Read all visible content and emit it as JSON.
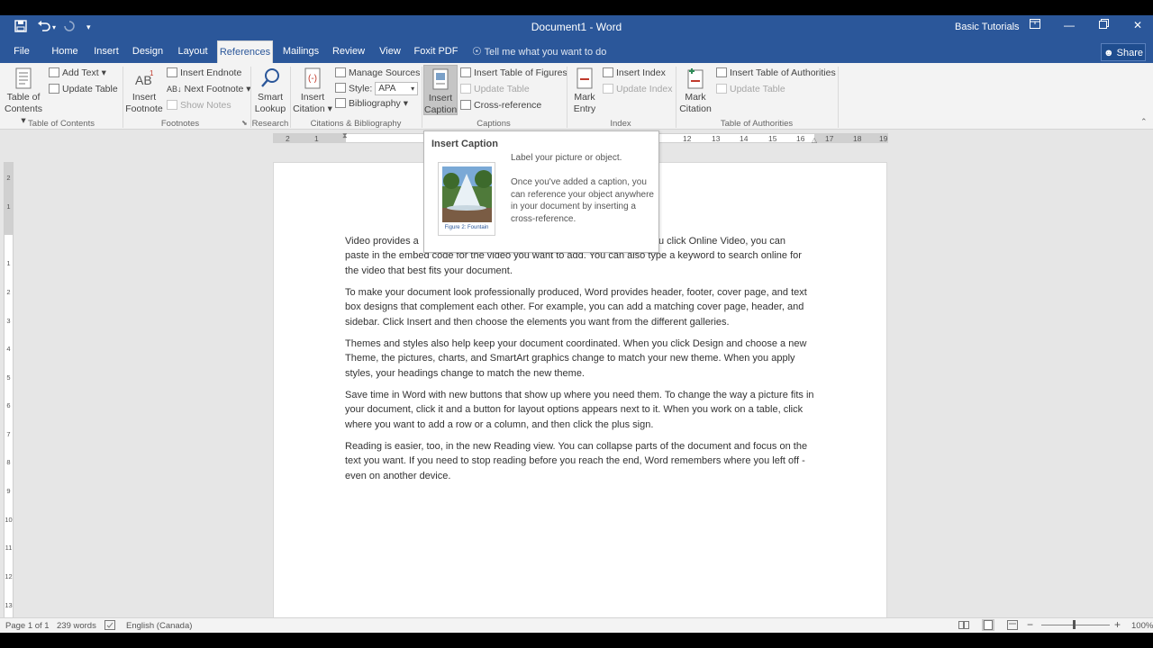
{
  "titlebar": {
    "document_title": "Document1  -  Word",
    "user_name": "Basic Tutorials",
    "save_icon": "save-icon",
    "undo_icon": "undo-icon",
    "redo_icon": "redo-icon"
  },
  "tabs": [
    "File",
    "Home",
    "Insert",
    "Design",
    "Layout",
    "References",
    "Mailings",
    "Review",
    "View",
    "Foxit PDF"
  ],
  "active_tab": "References",
  "tell_me": "Tell me what you want to do",
  "share_label": "Share",
  "ribbon": {
    "toc": {
      "button": "Table of",
      "button2": "Contents",
      "add_text": "Add Text",
      "update_table": "Update Table",
      "group": "Table of Contents"
    },
    "footnotes": {
      "insert_footnote": "Insert",
      "insert_footnote2": "Footnote",
      "insert_endnote": "Insert Endnote",
      "next_footnote": "Next Footnote",
      "show_notes": "Show Notes",
      "group": "Footnotes"
    },
    "research": {
      "smart_lookup": "Smart",
      "smart_lookup2": "Lookup",
      "group": "Research"
    },
    "citations": {
      "insert_citation": "Insert",
      "insert_citation2": "Citation",
      "manage_sources": "Manage Sources",
      "style_label": "Style:",
      "style_value": "APA",
      "bibliography": "Bibliography",
      "group": "Citations & Bibliography"
    },
    "captions": {
      "insert_caption": "Insert",
      "insert_caption2": "Caption",
      "insert_table_of_figures": "Insert Table of Figures",
      "update_table": "Update Table",
      "cross_reference": "Cross-reference",
      "group": "Captions"
    },
    "index": {
      "mark_entry": "Mark",
      "mark_entry2": "Entry",
      "insert_index": "Insert Index",
      "update_index": "Update Index",
      "group": "Index"
    },
    "authorities": {
      "mark_citation": "Mark",
      "mark_citation2": "Citation",
      "insert_toa": "Insert Table of Authorities",
      "update_table": "Update Table",
      "group": "Table of Authorities"
    }
  },
  "ruler": {
    "left_numbers": [
      "2",
      "1"
    ],
    "right_numbers": [
      "12",
      "13",
      "14",
      "15",
      "16",
      "17",
      "18",
      "19"
    ],
    "vertical_numbers": [
      "2",
      "1",
      "1",
      "2",
      "3",
      "4",
      "5",
      "6",
      "7",
      "8",
      "9",
      "10",
      "11",
      "12",
      "13"
    ]
  },
  "tooltip": {
    "title": "Insert Caption",
    "line1": "Label your picture or object.",
    "line2": "Once you've added a caption, you can reference your object anywhere in your document by inserting a cross-reference.",
    "figure_caption": "Figure 2: Fountain"
  },
  "document": {
    "p1_line1_a": "Video provides a",
    "p1_line1_b": "u click Online Video, you can",
    "p1_line2": "paste in the embed code for the video you want to add. You can also type a keyword to search online for",
    "p1_line3": "the video that best fits your document.",
    "p2": "To make your document look professionally produced, Word provides header, footer, cover page, and text box designs that complement each other. For example, you can add a matching cover page, header, and sidebar. Click Insert and then choose the elements you want from the different galleries.",
    "p3": "Themes and styles also help keep your document coordinated. When you click Design and choose a new Theme, the pictures, charts, and SmartArt graphics change to match your new theme. When you apply styles, your headings change to match the new theme.",
    "p4": "Save time in Word with new buttons that show up where you need them. To change the way a picture fits in your document, click it and a button for layout options appears next to it. When you work on a table, click where you want to add a row or a column, and then click the plus sign.",
    "p5": "Reading is easier, too, in the new Reading view. You can collapse parts of the document and focus on the text you want. If you need to stop reading before you reach the end, Word remembers where you left off - even on another device."
  },
  "status": {
    "page": "Page 1 of 1",
    "words": "239 words",
    "language": "English (Canada)",
    "zoom": "100%"
  },
  "colors": {
    "accent": "#2b579a"
  }
}
